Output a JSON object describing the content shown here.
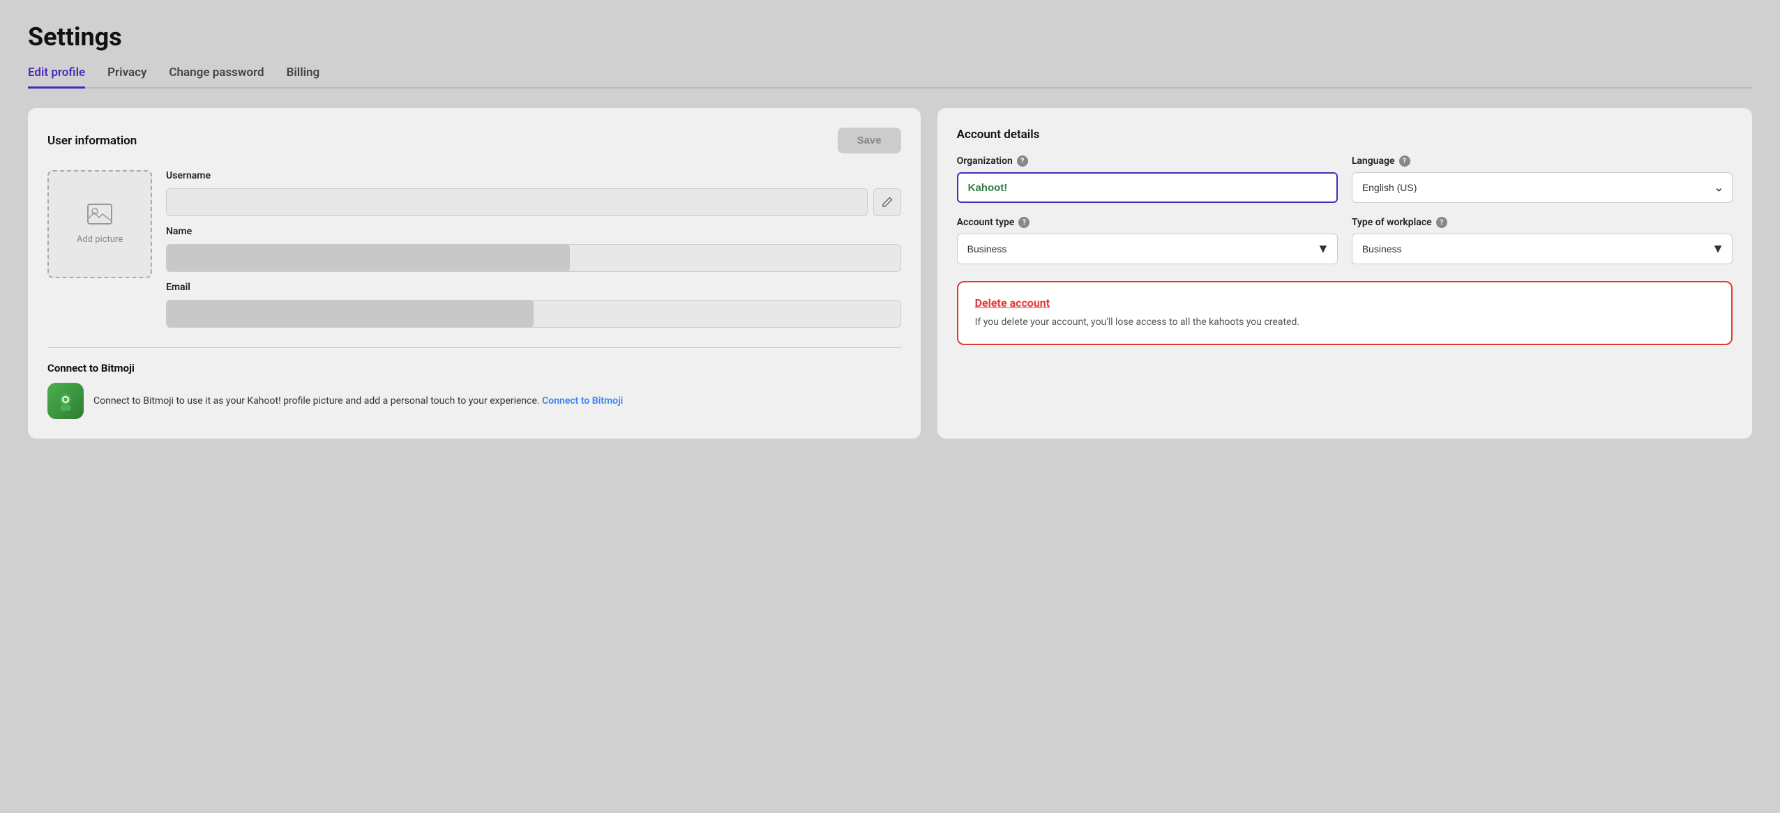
{
  "page": {
    "title": "Settings"
  },
  "tabs": [
    {
      "id": "edit-profile",
      "label": "Edit profile",
      "active": true
    },
    {
      "id": "privacy",
      "label": "Privacy",
      "active": false
    },
    {
      "id": "change-password",
      "label": "Change password",
      "active": false
    },
    {
      "id": "billing",
      "label": "Billing",
      "active": false
    }
  ],
  "left_card": {
    "title": "User information",
    "save_button": "Save",
    "avatar_label": "Add picture",
    "fields": {
      "username_label": "Username",
      "name_label": "Name",
      "email_label": "Email"
    },
    "connect_section": {
      "title": "Connect to Bitmoji",
      "description": "Connect to Bitmoji to use it as your Kahoot! profile picture and add a personal touch to your experience.",
      "link_text": "Connect to Bitmoji"
    }
  },
  "right_card": {
    "title": "Account details",
    "organization_label": "Organization",
    "organization_help": "?",
    "organization_value": "Kahoot!",
    "language_label": "Language",
    "language_help": "?",
    "language_value": "English (US)",
    "account_type_label": "Account type",
    "account_type_help": "?",
    "account_type_value": "Business",
    "workplace_label": "Type of workplace",
    "workplace_help": "?",
    "workplace_value": "Business",
    "delete_section": {
      "link_text": "Delete account",
      "description": "If you delete your account, you'll lose access to all the kahoots you created."
    }
  }
}
